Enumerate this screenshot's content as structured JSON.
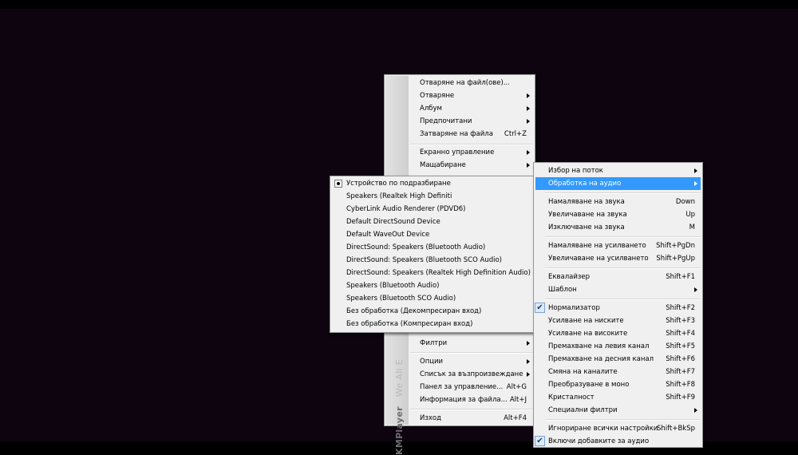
{
  "main_menu": {
    "items": [
      {
        "label": "Отваряне на файл(ове)...",
        "shortcut": "",
        "submenu": false
      },
      {
        "label": "Отваряне",
        "shortcut": "",
        "submenu": true
      },
      {
        "label": "Албум",
        "shortcut": "",
        "submenu": true
      },
      {
        "label": "Предпочитани",
        "shortcut": "",
        "submenu": true
      },
      {
        "label": "Затваряне на файла",
        "shortcut": "Ctrl+Z",
        "submenu": false
      },
      {
        "label": "Екранно управление",
        "shortcut": "",
        "submenu": true
      },
      {
        "label": "Мащабиране",
        "shortcut": "",
        "submenu": true
      },
      {
        "label": "Филтри",
        "shortcut": "",
        "submenu": true
      },
      {
        "label": "Опции",
        "shortcut": "",
        "submenu": true
      },
      {
        "label": "Списък за възпроизвеждане",
        "shortcut": "",
        "submenu": true
      },
      {
        "label": "Панел за управление...",
        "shortcut": "Alt+G",
        "submenu": false
      },
      {
        "label": "Информация за файла...",
        "shortcut": "Alt+J",
        "submenu": false
      },
      {
        "label": "Изход",
        "shortcut": "Alt+F4",
        "submenu": false
      }
    ],
    "brand": "KMPlayer",
    "brand_tagline": "We All E"
  },
  "audio_device_menu": {
    "selected_index": 0,
    "items": [
      "Устройство по подразбиране",
      "Speakers (Realtek High Definiti",
      "CyberLink Audio Renderer (PDVD6)",
      "Default DirectSound Device",
      "Default WaveOut Device",
      "DirectSound: Speakers (Bluetooth Audio)",
      "DirectSound: Speakers (Bluetooth SCO Audio)",
      "DirectSound: Speakers (Realtek High Definition Audio)",
      "Speakers (Bluetooth Audio)",
      "Speakers (Bluetooth SCO Audio)",
      "Без обработка (Декомпресиран вход)",
      "Без обработка (Компресиран вход)"
    ]
  },
  "audio_submenu": {
    "highlight_color": "#3399ff",
    "items": [
      {
        "label": "Избор на поток",
        "shortcut": "",
        "submenu": true,
        "checked": false
      },
      {
        "label": "Обработка на аудио",
        "shortcut": "",
        "submenu": true,
        "checked": false
      },
      {
        "label": "Намаляване на звука",
        "shortcut": "Down",
        "submenu": false,
        "checked": false
      },
      {
        "label": "Увеличаване на звука",
        "shortcut": "Up",
        "submenu": false,
        "checked": false
      },
      {
        "label": "Изключване на звука",
        "shortcut": "M",
        "submenu": false,
        "checked": false
      },
      {
        "label": "Намаляване на усилването",
        "shortcut": "Shift+PgDn",
        "submenu": false,
        "checked": false
      },
      {
        "label": "Увеличаване на усилването",
        "shortcut": "Shift+PgUp",
        "submenu": false,
        "checked": false
      },
      {
        "label": "Еквалайзер",
        "shortcut": "Shift+F1",
        "submenu": false,
        "checked": false
      },
      {
        "label": "Шаблон",
        "shortcut": "",
        "submenu": true,
        "checked": false
      },
      {
        "label": "Нормализатор",
        "shortcut": "Shift+F2",
        "submenu": false,
        "checked": true
      },
      {
        "label": "Усилване на ниските",
        "shortcut": "Shift+F3",
        "submenu": false,
        "checked": false
      },
      {
        "label": "Усилване на високите",
        "shortcut": "Shift+F4",
        "submenu": false,
        "checked": false
      },
      {
        "label": "Премахване на левия канал",
        "shortcut": "Shift+F5",
        "submenu": false,
        "checked": false
      },
      {
        "label": "Премахване на десния канал",
        "shortcut": "Shift+F6",
        "submenu": false,
        "checked": false
      },
      {
        "label": "Смяна на каналите",
        "shortcut": "Shift+F7",
        "submenu": false,
        "checked": false
      },
      {
        "label": "Преобразуване в моно",
        "shortcut": "Shift+F8",
        "submenu": false,
        "checked": false
      },
      {
        "label": "Кристалност",
        "shortcut": "Shift+F9",
        "submenu": false,
        "checked": false
      },
      {
        "label": "Специални филтри",
        "shortcut": "",
        "submenu": true,
        "checked": false
      },
      {
        "label": "Игнориране всички настройки",
        "shortcut": "Shift+BkSp",
        "submenu": false,
        "checked": false
      },
      {
        "label": "Включи добавките за аудио",
        "shortcut": "",
        "submenu": false,
        "checked": true
      }
    ]
  }
}
